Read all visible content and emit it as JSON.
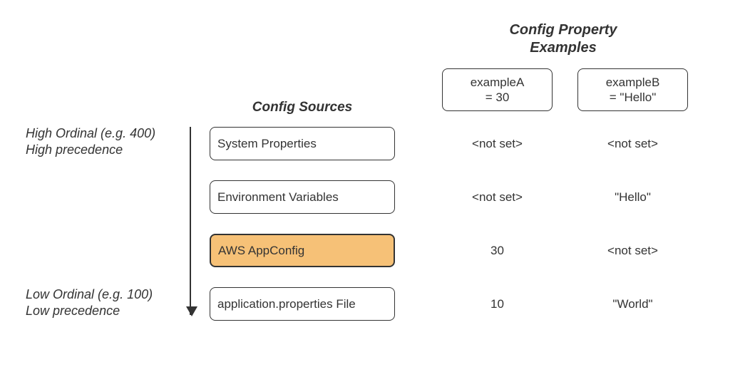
{
  "header": {
    "title_line1": "Config Property",
    "title_line2": "Examples"
  },
  "properties": {
    "a": {
      "name": "exampleA",
      "value_line": "= 30"
    },
    "b": {
      "name": "exampleB",
      "value_line": "= \"Hello\""
    }
  },
  "sources_heading": "Config Sources",
  "ordinal": {
    "high_line1": "High Ordinal (e.g. 400)",
    "high_line2": "High precedence",
    "low_line1": "Low Ordinal (e.g. 100)",
    "low_line2": "Low precedence"
  },
  "rows": [
    {
      "source": "System Properties",
      "a": "<not set>",
      "b": "<not set>",
      "highlight": false
    },
    {
      "source": "Environment Variables",
      "a": "<not set>",
      "b": "\"Hello\"",
      "highlight": false
    },
    {
      "source": "AWS AppConfig",
      "a": "30",
      "b": "<not set>",
      "highlight": true
    },
    {
      "source": "application.properties File",
      "a": "10",
      "b": "\"World\"",
      "highlight": false
    }
  ],
  "colors": {
    "highlight_bg": "#f6c177"
  }
}
